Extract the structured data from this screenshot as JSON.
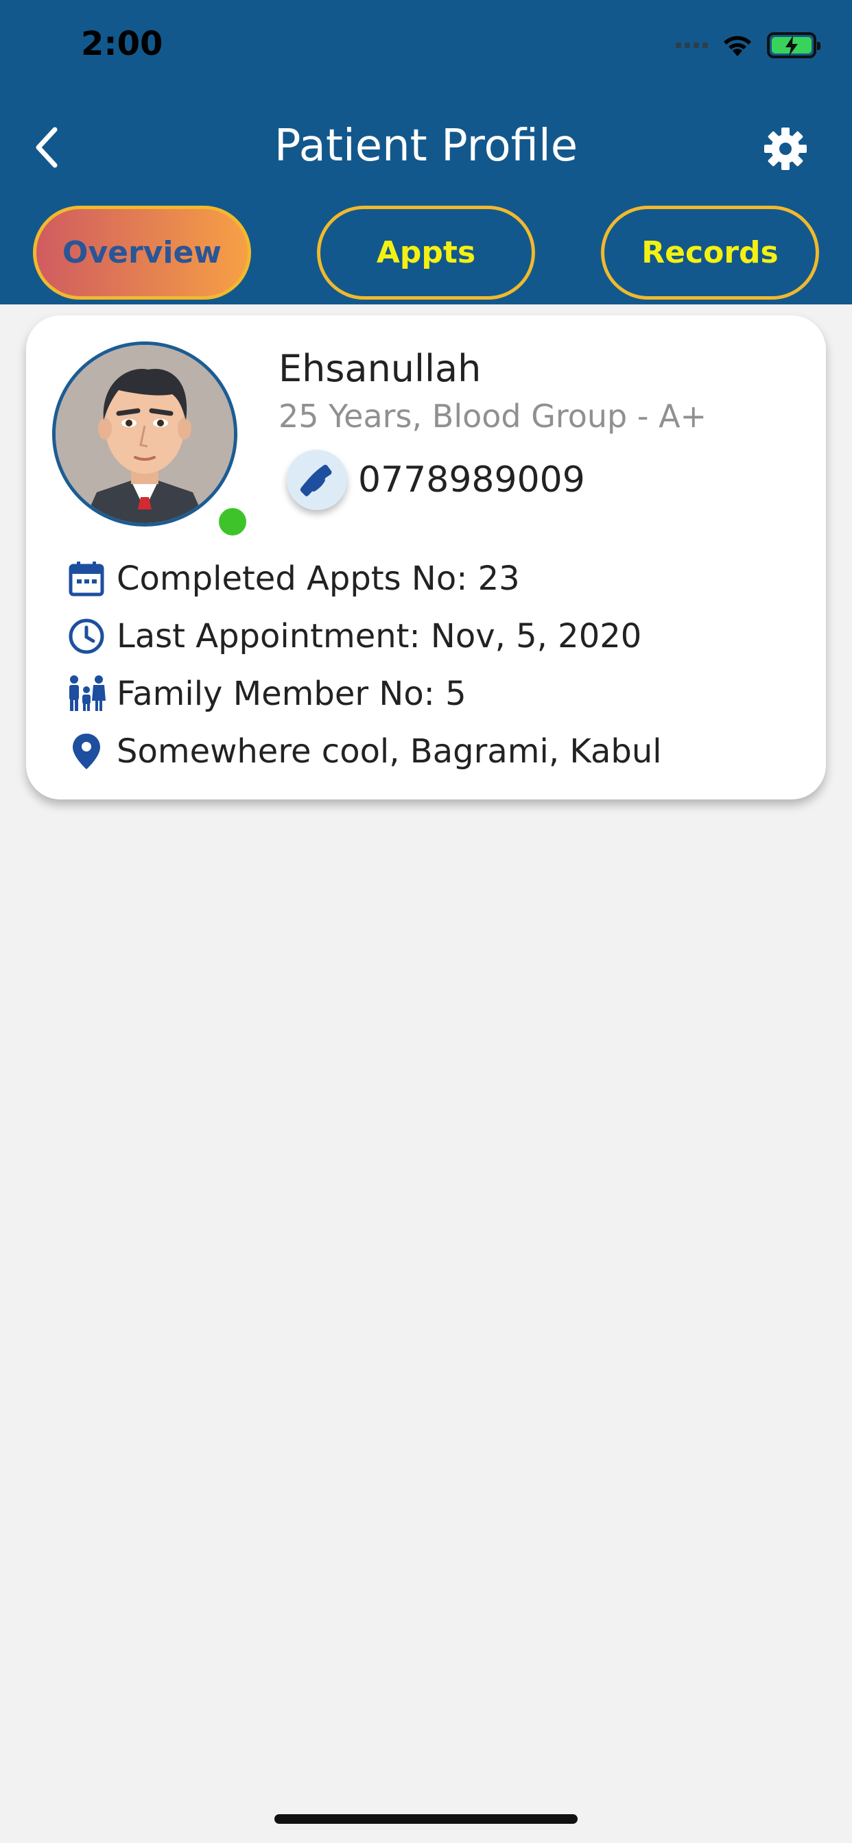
{
  "status_bar": {
    "time": "2:00"
  },
  "header": {
    "title": "Patient Profile"
  },
  "tabs": [
    {
      "label": "Overview",
      "active": true
    },
    {
      "label": "Appts",
      "active": false
    },
    {
      "label": "Records",
      "active": false
    }
  ],
  "patient": {
    "name": "Ehsanullah",
    "meta": "25 Years, Blood Group - A+",
    "phone": "0778989009",
    "online": true
  },
  "info": [
    {
      "icon": "calendar-icon",
      "text": "Completed Appts No: 23"
    },
    {
      "icon": "clock-icon",
      "text": "Last Appointment: Nov, 5, 2020"
    },
    {
      "icon": "family-icon",
      "text": "Family Member No: 5"
    },
    {
      "icon": "location-pin-icon",
      "text": "Somewhere cool, Bagrami, Kabul"
    }
  ],
  "colors": {
    "header_bg": "#13588c",
    "tab_border": "#f1b92d",
    "tab_text": "#f4f112",
    "accent_blue": "#1d4f9e",
    "online": "#3ec42a"
  }
}
